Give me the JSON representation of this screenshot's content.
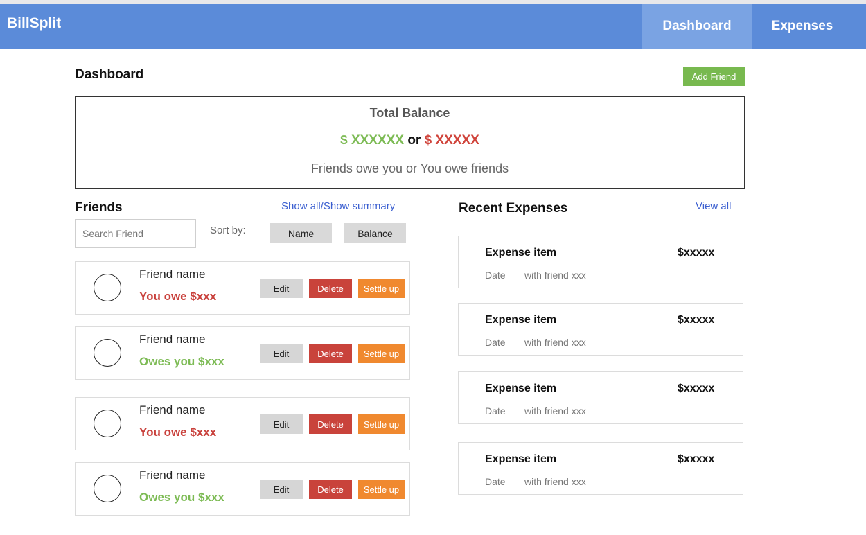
{
  "app": {
    "brand": "BillSplit"
  },
  "nav": {
    "dashboard": "Dashboard",
    "expenses": "Expenses",
    "active": "Dashboard"
  },
  "page": {
    "title": "Dashboard",
    "add_friend_label": "Add Friend"
  },
  "balance": {
    "title": "Total Balance",
    "owed_amount": "$ XXXXXX",
    "separator": "or",
    "owe_amount": "$ XXXXX",
    "caption": "Friends owe you or You owe friends"
  },
  "friends": {
    "heading": "Friends",
    "toggle_label": "Show all/Show summary",
    "search_placeholder": "Search Friend",
    "sort_label": "Sort by:",
    "sort_options": [
      "Name",
      "Balance"
    ],
    "actions": {
      "edit": "Edit",
      "delete": "Delete",
      "settle": "Settle up"
    },
    "items": [
      {
        "name": "Friend name",
        "status": "You owe $xxx",
        "type": "owe"
      },
      {
        "name": "Friend name",
        "status": "Owes you $xxx",
        "type": "owed"
      },
      {
        "name": "Friend name",
        "status": "You owe $xxx",
        "type": "owe"
      },
      {
        "name": "Friend name",
        "status": "Owes you $xxx",
        "type": "owed"
      }
    ]
  },
  "expenses": {
    "heading": "Recent Expenses",
    "view_all_label": "View all",
    "items": [
      {
        "item": "Expense item",
        "amount": "$xxxxx",
        "date": "Date",
        "with": "with  friend xxx"
      },
      {
        "item": "Expense item",
        "amount": "$xxxxx",
        "date": "Date",
        "with": "with  friend xxx"
      },
      {
        "item": "Expense item",
        "amount": "$xxxxx",
        "date": "Date",
        "with": "with  friend xxx"
      },
      {
        "item": "Expense item",
        "amount": "$xxxxx",
        "date": "Date",
        "with": "with  friend xxx"
      }
    ]
  },
  "colors": {
    "nav_bg": "#5b8bd9",
    "nav_active_bg": "#7aa3e3",
    "positive": "#7dbb55",
    "negative": "#c9413c",
    "settle": "#f0892f",
    "link": "#3b5fd0"
  }
}
